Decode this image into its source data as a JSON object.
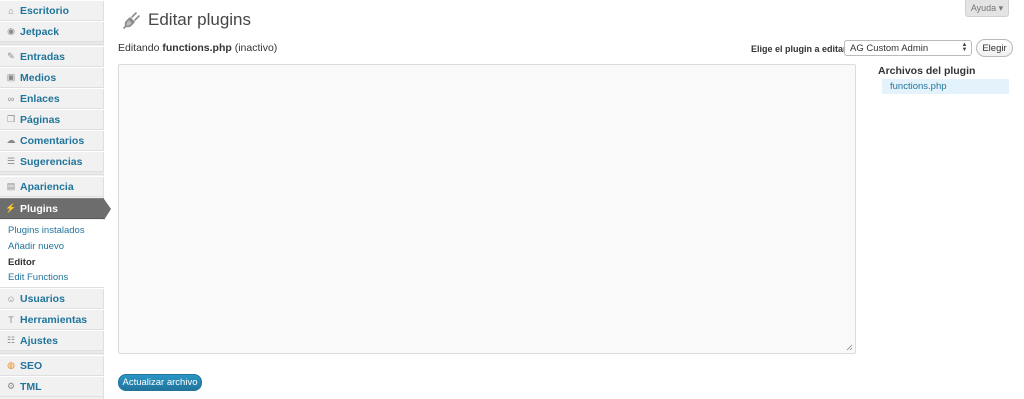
{
  "sidebar": {
    "items": [
      {
        "label": "Escritorio",
        "icon": "dashboard-icon"
      },
      {
        "label": "Jetpack",
        "icon": "jetpack-icon"
      },
      {
        "label": "Entradas",
        "icon": "pin-icon"
      },
      {
        "label": "Medios",
        "icon": "media-icon"
      },
      {
        "label": "Enlaces",
        "icon": "link-icon"
      },
      {
        "label": "Páginas",
        "icon": "pages-icon"
      },
      {
        "label": "Comentarios",
        "icon": "comment-icon"
      },
      {
        "label": "Sugerencias",
        "icon": "feedback-icon"
      },
      {
        "label": "Apariencia",
        "icon": "appearance-icon"
      },
      {
        "label": "Plugins",
        "icon": "plugin-icon"
      },
      {
        "label": "Usuarios",
        "icon": "users-icon"
      },
      {
        "label": "Herramientas",
        "icon": "tools-icon"
      },
      {
        "label": "Ajustes",
        "icon": "settings-icon"
      },
      {
        "label": "SEO",
        "icon": "seo-icon"
      },
      {
        "label": "TML",
        "icon": "gear-icon"
      }
    ],
    "submenu": [
      {
        "label": "Plugins instalados"
      },
      {
        "label": "Añadir nuevo"
      },
      {
        "label": "Editor"
      },
      {
        "label": "Edit Functions"
      }
    ]
  },
  "header": {
    "title": "Editar plugins",
    "help_label": "Ayuda ▾"
  },
  "editing": {
    "prefix": "Editando ",
    "filename": "functions.php",
    "status": " (inactivo)"
  },
  "chooser": {
    "label": "Elige el plugin a editar:",
    "selected": "AG Custom Admin",
    "button_label": "Elegir"
  },
  "files": {
    "title": "Archivos del plugin",
    "items": [
      "functions.php"
    ]
  },
  "update_button_label": "Actualizar archivo",
  "colors": {
    "link": "#21759b",
    "active_menu": "#6d6d6d",
    "primary_button": "#21759b"
  }
}
